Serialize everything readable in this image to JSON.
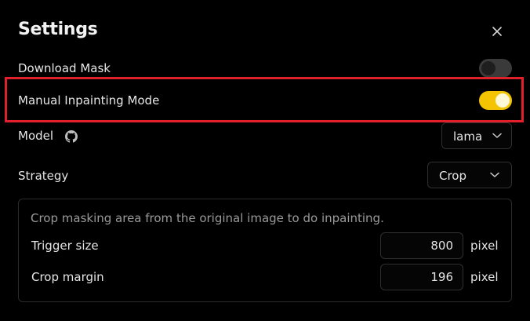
{
  "dialog": {
    "title": "Settings",
    "close_icon": "close-icon"
  },
  "settings": {
    "download_mask": {
      "label": "Download Mask",
      "enabled": false
    },
    "manual_inpainting": {
      "label": "Manual Inpainting Mode",
      "enabled": true
    },
    "model": {
      "label": "Model",
      "icon": "github-icon",
      "value": "lama"
    },
    "strategy": {
      "label": "Strategy",
      "value": "Crop"
    }
  },
  "crop": {
    "description": "Crop masking area from the original image to do inpainting.",
    "trigger_size": {
      "label": "Trigger size",
      "value": "800",
      "unit": "pixel"
    },
    "crop_margin": {
      "label": "Crop margin",
      "value": "196",
      "unit": "pixel"
    }
  },
  "colors": {
    "accent": "#f5c400",
    "highlight": "#e0202b",
    "background": "#000000"
  }
}
